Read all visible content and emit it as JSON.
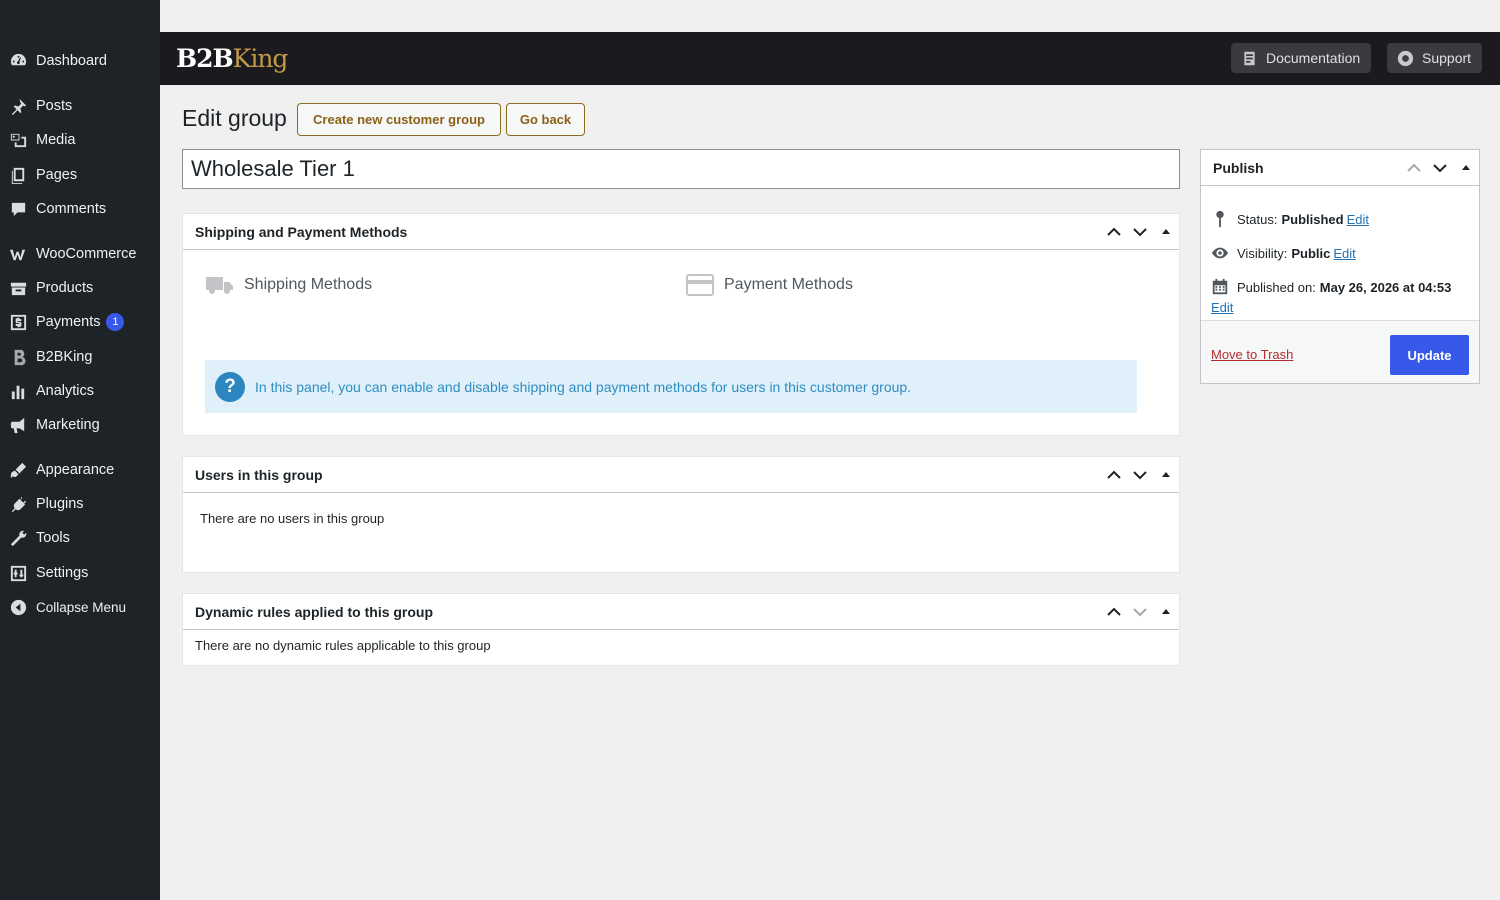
{
  "sidebar": {
    "items": [
      {
        "label": "Dashboard",
        "icon": "dashboard-icon"
      },
      {
        "label": "Posts",
        "icon": "pin-icon"
      },
      {
        "label": "Media",
        "icon": "media-icon"
      },
      {
        "label": "Pages",
        "icon": "pages-icon"
      },
      {
        "label": "Comments",
        "icon": "comment-icon"
      },
      {
        "label": "WooCommerce",
        "icon": "woocommerce-icon"
      },
      {
        "label": "Products",
        "icon": "archive-icon"
      },
      {
        "label": "Payments",
        "icon": "dollar-icon",
        "badge": "1"
      },
      {
        "label": "B2BKing",
        "icon": "b2bking-icon"
      },
      {
        "label": "Analytics",
        "icon": "bar-chart-icon"
      },
      {
        "label": "Marketing",
        "icon": "megaphone-icon"
      },
      {
        "label": "Appearance",
        "icon": "brush-icon"
      },
      {
        "label": "Plugins",
        "icon": "plug-icon"
      },
      {
        "label": "Tools",
        "icon": "wrench-icon"
      },
      {
        "label": "Settings",
        "icon": "settings-icon"
      },
      {
        "label": "Collapse Menu",
        "icon": "collapse-icon"
      }
    ]
  },
  "header": {
    "logo_b2b": "B2B",
    "logo_king": "King",
    "documentation_label": "Documentation",
    "support_label": "Support"
  },
  "page": {
    "title": "Edit group",
    "create_button": "Create new customer group",
    "back_button": "Go back",
    "group_name": "Wholesale Tier 1"
  },
  "shipping_box": {
    "title": "Shipping and Payment Methods",
    "shipping_label": "Shipping Methods",
    "payment_label": "Payment Methods",
    "info_text": "In this panel, you can enable and disable shipping and payment methods for users in this customer group."
  },
  "users_box": {
    "title": "Users in this group",
    "empty": "There are no users in this group"
  },
  "rules_box": {
    "title": "Dynamic rules applied to this group",
    "empty": "There are no dynamic rules applicable to this group"
  },
  "publish": {
    "title": "Publish",
    "status_label": "Status:",
    "status_value": "Published",
    "visibility_label": "Visibility:",
    "visibility_value": "Public",
    "published_label": "Published on:",
    "published_value": "May 26, 2026 at 04:53",
    "edit_label": "Edit",
    "trash_label": "Move to Trash",
    "update_label": "Update"
  },
  "colors": {
    "accent": "#3858e9",
    "sidebar_bg": "#1d2327",
    "header_bg": "#1a1a1f",
    "brand_gold": "#c49a49",
    "trash_red": "#b32d2e",
    "info_bg": "#dff0fb"
  }
}
